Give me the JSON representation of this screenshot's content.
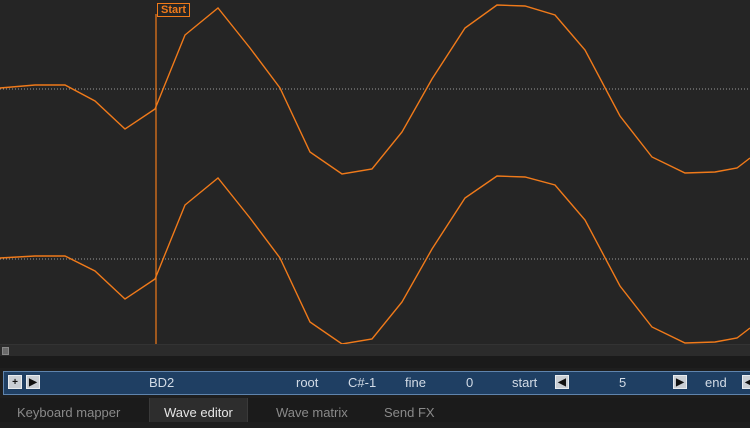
{
  "waveform": {
    "start_marker_label": "Start",
    "wave_color": "#f07a1a",
    "channels": [
      [
        [
          0,
          88
        ],
        [
          35,
          85
        ],
        [
          65,
          85
        ],
        [
          95,
          101
        ],
        [
          125,
          129
        ],
        [
          155,
          109
        ],
        [
          185,
          35
        ],
        [
          218,
          8
        ],
        [
          250,
          48
        ],
        [
          280,
          88
        ],
        [
          310,
          152
        ],
        [
          342,
          174
        ],
        [
          372,
          169
        ],
        [
          402,
          132
        ],
        [
          432,
          79
        ],
        [
          465,
          28
        ],
        [
          497,
          5
        ],
        [
          525,
          6
        ],
        [
          555,
          15
        ],
        [
          585,
          50
        ],
        [
          620,
          116
        ],
        [
          652,
          157
        ],
        [
          685,
          173
        ],
        [
          715,
          172
        ],
        [
          737,
          168
        ],
        [
          750,
          158
        ]
      ],
      [
        [
          0,
          258
        ],
        [
          35,
          256
        ],
        [
          65,
          256
        ],
        [
          95,
          271
        ],
        [
          125,
          299
        ],
        [
          155,
          279
        ],
        [
          185,
          205
        ],
        [
          218,
          178
        ],
        [
          250,
          218
        ],
        [
          280,
          258
        ],
        [
          310,
          322
        ],
        [
          342,
          344
        ],
        [
          372,
          339
        ],
        [
          402,
          302
        ],
        [
          432,
          249
        ],
        [
          465,
          198
        ],
        [
          497,
          176
        ],
        [
          525,
          177
        ],
        [
          555,
          185
        ],
        [
          585,
          220
        ],
        [
          620,
          286
        ],
        [
          652,
          327
        ],
        [
          685,
          343
        ],
        [
          715,
          342
        ],
        [
          737,
          338
        ],
        [
          750,
          328
        ]
      ]
    ]
  },
  "param_bar": {
    "sample_name": "BD2",
    "root_label": "root",
    "root_value": "C#-1",
    "fine_label": "fine",
    "fine_value": "0",
    "start_label": "start",
    "start_value": "5",
    "end_label": "end"
  },
  "tabs": [
    {
      "label": "Keyboard mapper"
    },
    {
      "label": "Wave editor"
    },
    {
      "label": "Wave matrix"
    },
    {
      "label": "Send FX"
    }
  ]
}
